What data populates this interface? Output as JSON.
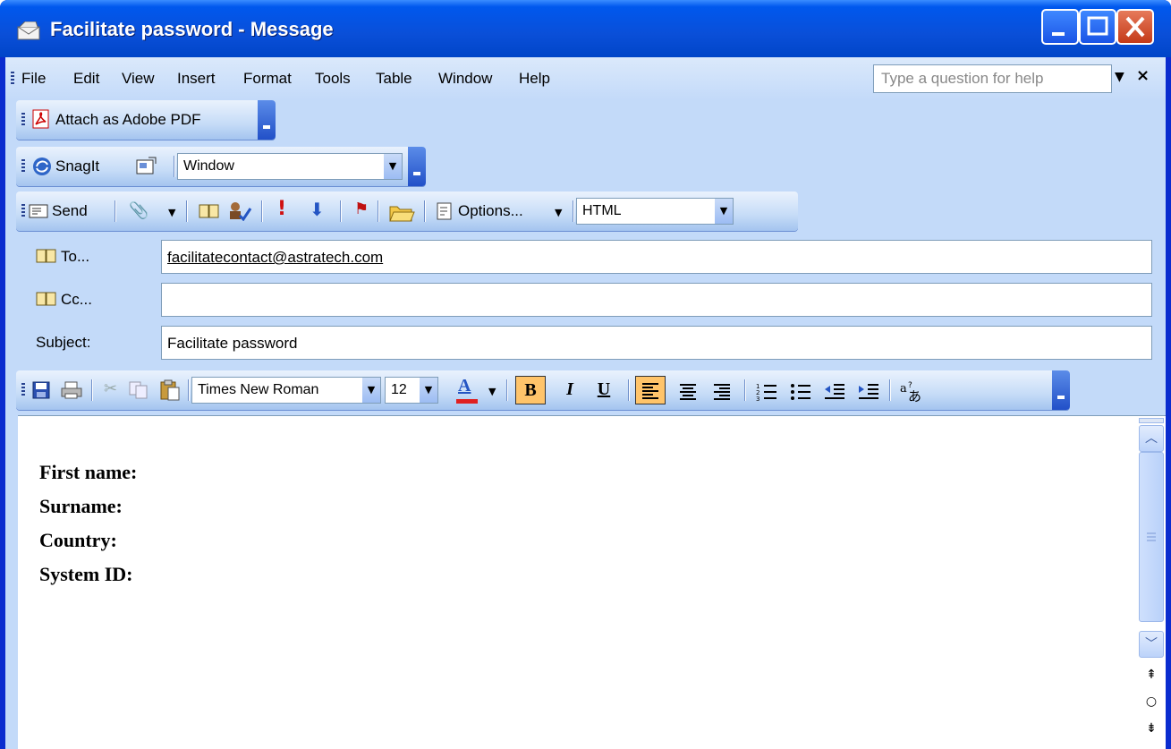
{
  "window": {
    "title": "Facilitate password - Message"
  },
  "menubar": {
    "items": [
      "File",
      "Edit",
      "View",
      "Insert",
      "Format",
      "Tools",
      "Table",
      "Window",
      "Help"
    ],
    "help_placeholder": "Type a question for help",
    "help_close": "×"
  },
  "pdf_toolbar": {
    "attach_label": "Attach as Adobe PDF"
  },
  "snagit_toolbar": {
    "snagit_label": "SnagIt",
    "mode_value": "Window"
  },
  "send_toolbar": {
    "send_label": "Send",
    "options_label": "Options...",
    "format_value": "HTML"
  },
  "fields": {
    "to_label": "To...",
    "to_value": "facilitatecontact@astratech.com",
    "cc_label": "Cc...",
    "cc_value": "",
    "subject_label": "Subject:",
    "subject_value": "Facilitate password"
  },
  "format_toolbar": {
    "font_name": "Times New Roman",
    "font_size": "12",
    "bold": "B",
    "italic": "I",
    "underline": "U",
    "font_color": "#e02020",
    "font_color_letter": "A"
  },
  "body": {
    "lines": [
      "First name:",
      "Surname:",
      "Country:",
      "System ID:"
    ]
  }
}
